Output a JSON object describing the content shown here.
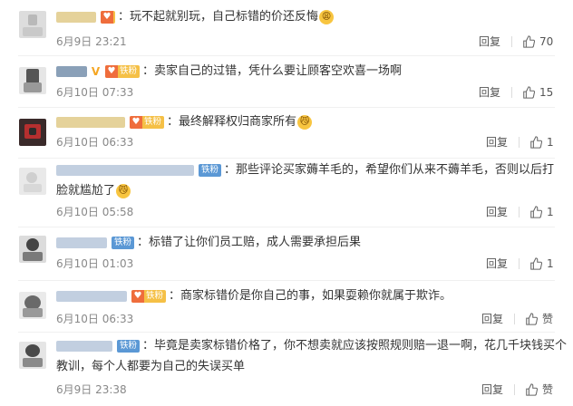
{
  "comments": [
    {
      "text": "玩不起就别玩，自己标错的价还反悔",
      "badge": "",
      "emoji": "😩",
      "time": "6月9日 23:21",
      "reply": "回复",
      "likes": "70"
    },
    {
      "text": "卖家自己的过错，凭什么要让顾客空欢喜一场啊",
      "badge": "铁粉",
      "emoji": "",
      "time": "6月10日 07:33",
      "reply": "回复",
      "likes": "15"
    },
    {
      "text": "最终解释权归商家所有",
      "badge": "铁粉",
      "emoji": "😼",
      "time": "6月10日 06:33",
      "reply": "回复",
      "likes": "1"
    },
    {
      "text": "那些评论买家薅羊毛的，希望你们从来不薅羊毛，否则以后打",
      "text2": "脸就尴尬了",
      "badge": "铁粉",
      "emoji": "😼",
      "time": "6月10日 05:58",
      "reply": "回复",
      "likes": "1"
    },
    {
      "text": "标错了让你们员工赔，成人需要承担后果",
      "badge": "铁粉",
      "emoji": "",
      "time": "6月10日 01:03",
      "reply": "回复",
      "likes": "1"
    },
    {
      "text": "商家标错价是你自己的事，如果耍赖你就属于欺诈。",
      "badge": "铁粉",
      "emoji": "",
      "time": "6月10日 06:33",
      "reply": "回复",
      "likes": "赞"
    },
    {
      "text": "毕竟是卖家标错价格了，你不想卖就应该按照规则赔一退一啊，花几千块钱买个",
      "text2": "教训，每个人都要为自己的失误买单",
      "badge": "铁粉",
      "emoji": "",
      "time": "6月9日 23:38",
      "reply": "回复",
      "likes": "赞"
    }
  ]
}
